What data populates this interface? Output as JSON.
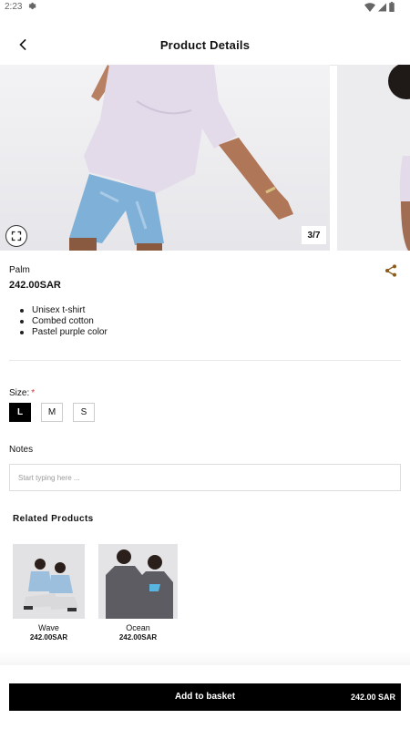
{
  "status_bar": {
    "time": "2:23"
  },
  "header": {
    "title": "Product Details"
  },
  "gallery": {
    "counter": "3/7"
  },
  "product": {
    "name": "Palm",
    "price": "242.00SAR",
    "features": [
      "Unisex t-shirt",
      "Combed cotton",
      "Pastel purple color"
    ]
  },
  "size": {
    "label": "Size:",
    "required_mark": "*",
    "options": [
      "L",
      "M",
      "S"
    ],
    "selected": "L"
  },
  "notes": {
    "label": "Notes",
    "placeholder": "Start typing here ...",
    "value": ""
  },
  "related": {
    "title": "Related Products",
    "items": [
      {
        "name": "Wave",
        "price": "242.00SAR"
      },
      {
        "name": "Ocean",
        "price": "242.00SAR"
      }
    ]
  },
  "basket": {
    "label": "Add to basket",
    "total": "242.00 SAR"
  },
  "colors": {
    "accent": "#8a5a1a",
    "primary_button": "#000000",
    "required": "#dd3333",
    "tshirt": "#e3dbea"
  },
  "icons": [
    "gear-icon",
    "wifi-icon",
    "signal-icon",
    "battery-icon",
    "back-arrow-icon",
    "expand-icon",
    "share-icon"
  ]
}
